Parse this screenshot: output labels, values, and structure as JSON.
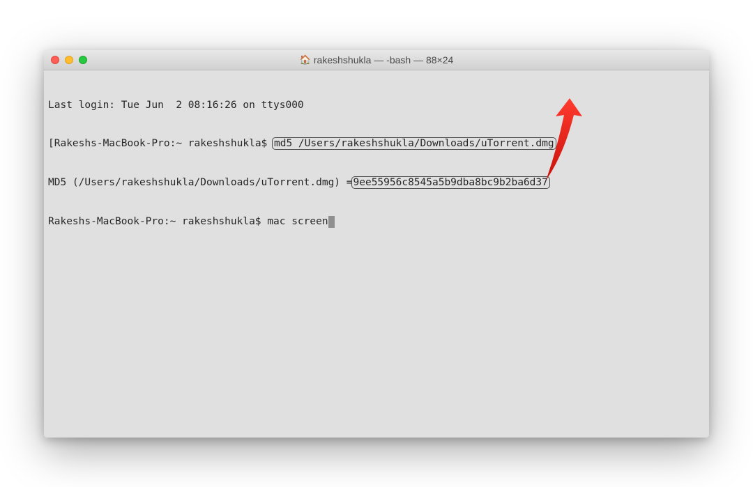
{
  "window": {
    "title": "rakeshshukla — -bash — 88×24"
  },
  "terminal": {
    "line1": "Last login: Tue Jun  2 08:16:26 on ttys000",
    "line2_prompt_bracket": "[",
    "line2_prompt": "Rakeshs-MacBook-Pro:~ rakeshshukla$ ",
    "line2_cmd": "md5 /Users/rakeshshukla/Downloads/uTorrent.dmg",
    "line3_prefix": "MD5 (/Users/rakeshshukla/Downloads/uTorrent.dmg) =",
    "line3_hash": "9ee55956c8545a5b9dba8bc9b2ba6d37",
    "line4_prompt": "Rakeshs-MacBook-Pro:~ rakeshshukla$ ",
    "line4_cmd": "mac screen"
  }
}
